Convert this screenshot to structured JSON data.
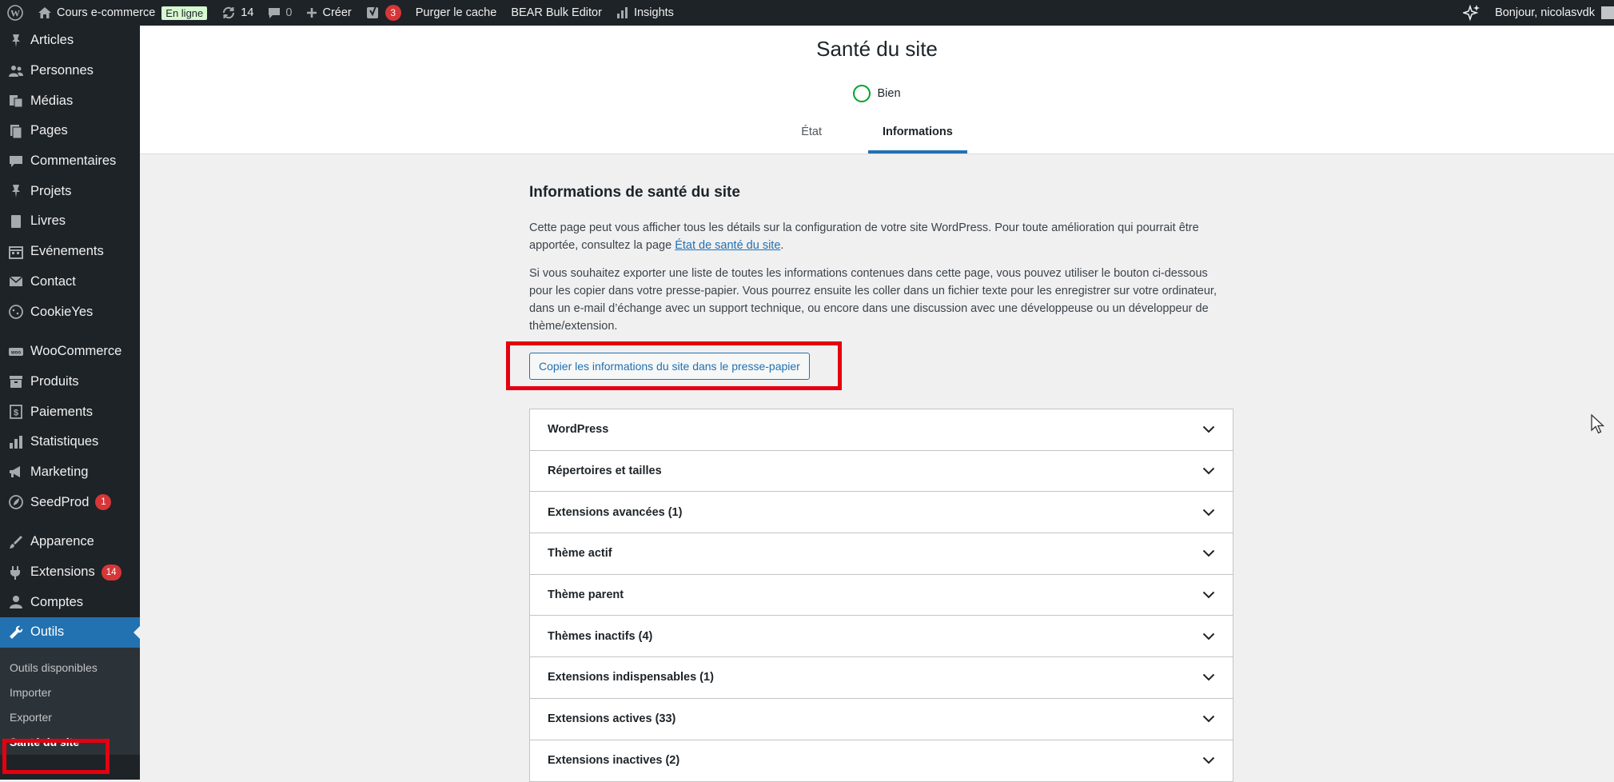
{
  "adminbar": {
    "site_name": "Cours e-commerce",
    "online_badge": "En ligne",
    "updates_count": "14",
    "comments_count": "0",
    "create_label": "Créer",
    "yoast_count": "3",
    "purge_cache": "Purger le cache",
    "bear_bulk": "BEAR Bulk Editor",
    "insights": "Insights",
    "greeting": "Bonjour, nicolasvdk"
  },
  "sidebar": {
    "items": [
      {
        "label": "Articles",
        "icon": "pin-icon"
      },
      {
        "label": "Personnes",
        "icon": "people-icon"
      },
      {
        "label": "Médias",
        "icon": "media-icon"
      },
      {
        "label": "Pages",
        "icon": "pages-icon"
      },
      {
        "label": "Commentaires",
        "icon": "comment-icon"
      },
      {
        "label": "Projets",
        "icon": "pin-icon"
      },
      {
        "label": "Livres",
        "icon": "book-icon"
      },
      {
        "label": "Evénements",
        "icon": "calendar-icon"
      },
      {
        "label": "Contact",
        "icon": "mail-icon"
      },
      {
        "label": "CookieYes",
        "icon": "cookie-icon"
      },
      {
        "label": "WooCommerce",
        "icon": "woo-icon"
      },
      {
        "label": "Produits",
        "icon": "archive-icon"
      },
      {
        "label": "Paiements",
        "icon": "money-icon"
      },
      {
        "label": "Statistiques",
        "icon": "chart-icon"
      },
      {
        "label": "Marketing",
        "icon": "megaphone-icon"
      },
      {
        "label": "SeedProd",
        "icon": "seedprod-icon",
        "badge": "1"
      },
      {
        "label": "Apparence",
        "icon": "brush-icon"
      },
      {
        "label": "Extensions",
        "icon": "plugin-icon",
        "badge": "14"
      },
      {
        "label": "Comptes",
        "icon": "user-icon"
      },
      {
        "label": "Outils",
        "icon": "wrench-icon"
      }
    ],
    "submenu": [
      "Outils disponibles",
      "Importer",
      "Exporter",
      "Santé du site"
    ]
  },
  "header": {
    "title": "Santé du site",
    "status": "Bien",
    "tabs": [
      "État",
      "Informations"
    ]
  },
  "content": {
    "heading": "Informations de santé du site",
    "para1_before": "Cette page peut vous afficher tous les détails sur la configuration de votre site WordPress. Pour toute amélioration qui pourrait être apportée, consultez la page ",
    "para1_link": "État de santé du site",
    "para1_after": ".",
    "para2": "Si vous souhaitez exporter une liste de toutes les informations contenues dans cette page, vous pouvez utiliser le bouton ci-dessous pour les copier dans votre presse-papier. Vous pourrez ensuite les coller dans un fichier texte pour les enregistrer sur votre ordinateur, dans un e-mail d’échange avec un support technique, ou encore dans une discussion avec une développeuse ou un développeur de thème/extension.",
    "copy_button": "Copier les informations du site dans le presse-papier"
  },
  "accordion": [
    "WordPress",
    "Répertoires et tailles",
    "Extensions avancées (1)",
    "Thème actif",
    "Thème parent",
    "Thèmes inactifs (4)",
    "Extensions indispensables (1)",
    "Extensions actives (33)",
    "Extensions inactives (2)"
  ],
  "colors": {
    "admin_dark": "#1d2327",
    "accent": "#2271b1",
    "highlight": "#e5000f",
    "good": "#00a32a"
  }
}
